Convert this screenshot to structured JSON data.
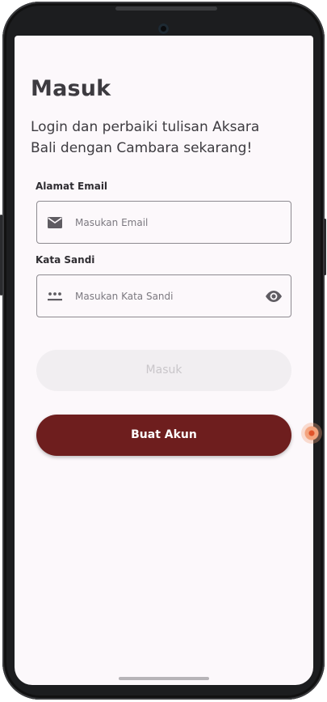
{
  "login": {
    "title": "Masuk",
    "subtitle": "Login dan perbaiki tulisan Aksara Bali dengan Cambara sekarang!",
    "email": {
      "label": "Alamat Email",
      "placeholder": "Masukan Email",
      "value": ""
    },
    "password": {
      "label": "Kata Sandi",
      "placeholder": "Masukan Kata Sandi",
      "value": ""
    },
    "login_button": "Masuk",
    "register_button": "Buat Akun"
  },
  "icons": {
    "email_icon": "envelope-icon",
    "password_icon": "password-dots-icon",
    "visibility_icon": "eye-icon"
  },
  "colors": {
    "screen_background": "#fcf8fb",
    "primary": "#6e1e1e",
    "disabled_button": "#f1eef1",
    "text": "#3d3b40"
  }
}
